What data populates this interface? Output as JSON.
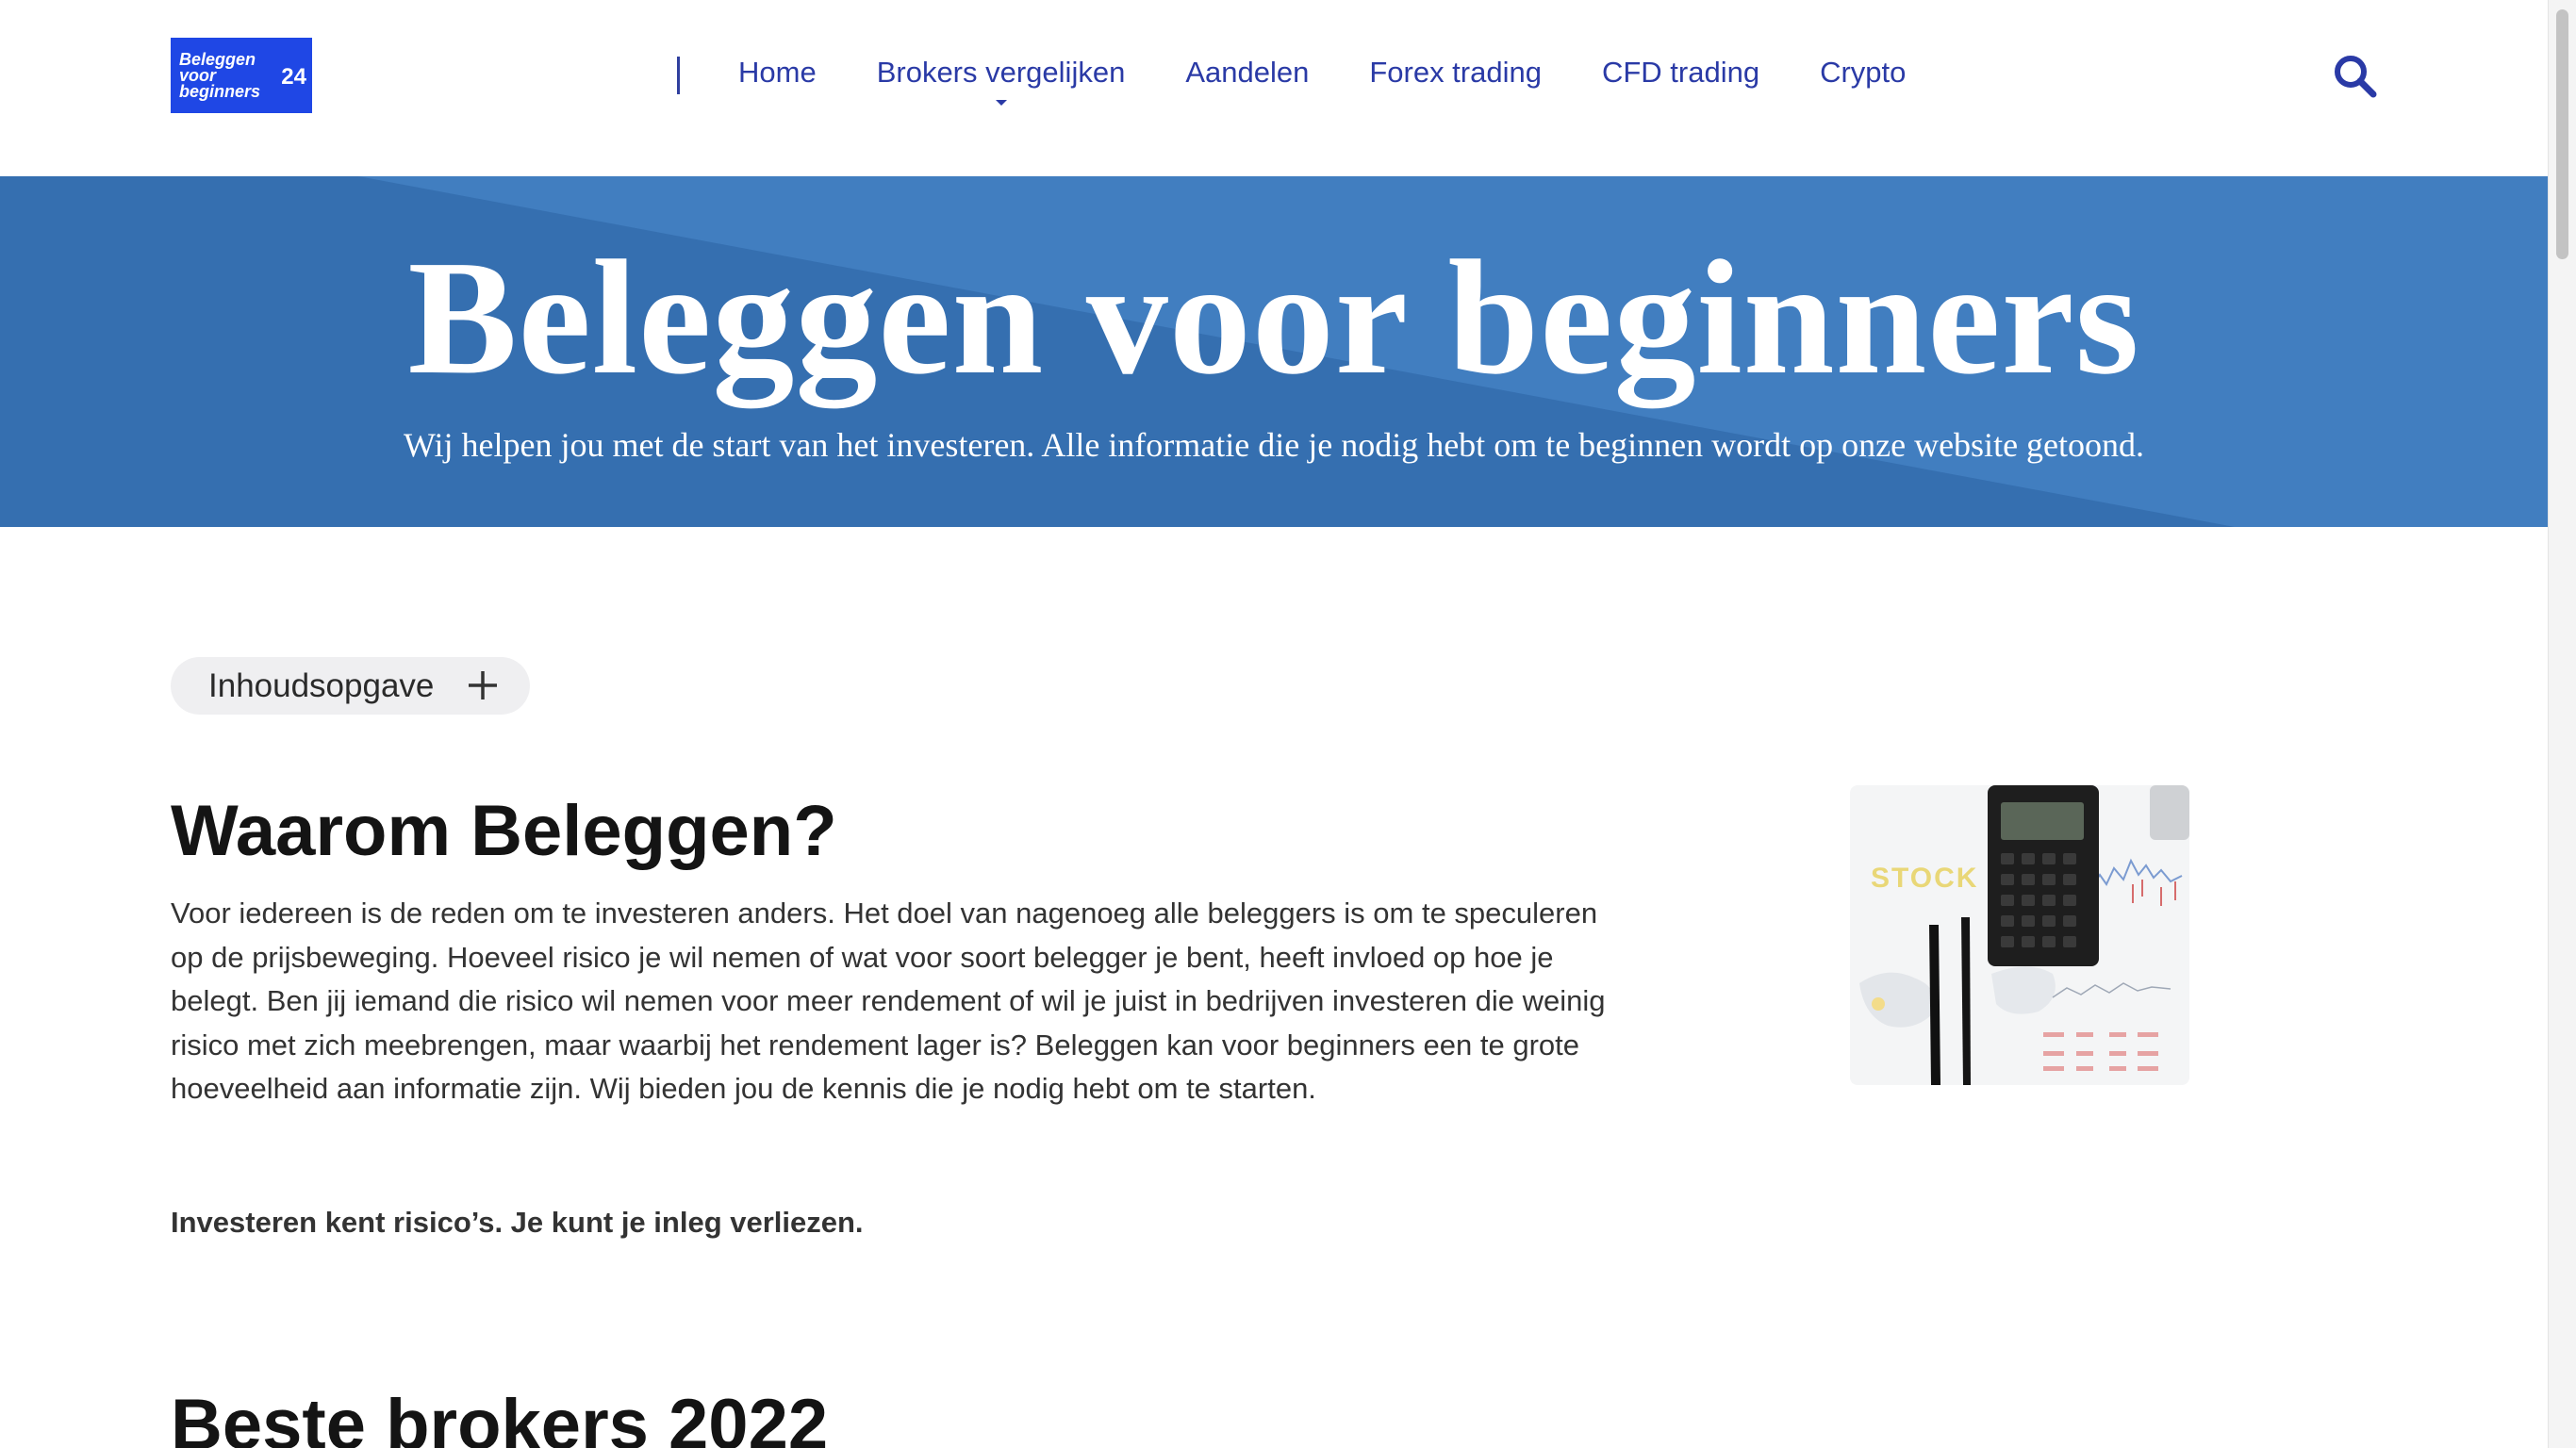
{
  "header": {
    "logo": {
      "text": "Beleggen\nvoor\nbeginners",
      "number": "24",
      "color": "#1f47e5"
    },
    "nav": [
      {
        "label": "Home",
        "has_dropdown": false
      },
      {
        "label": "Brokers vergelijken",
        "has_dropdown": true
      },
      {
        "label": "Aandelen",
        "has_dropdown": false
      },
      {
        "label": "Forex trading",
        "has_dropdown": false
      },
      {
        "label": "CFD trading",
        "has_dropdown": false
      },
      {
        "label": "Crypto",
        "has_dropdown": false
      }
    ],
    "search_icon": "search-icon",
    "link_color": "#2a3aa6"
  },
  "hero": {
    "title": "Beleggen voor beginners",
    "subtitle": "Wij helpen jou met de start van het investeren. Alle informatie die je nodig hebt om te beginnen wordt op onze website getoond.",
    "background_color": "#356fb0"
  },
  "toc": {
    "label": "Inhoudsopgave",
    "icon": "plus-icon"
  },
  "section1": {
    "title": "Waarom Beleggen?",
    "body": "Voor iedereen is de reden om te investeren anders.  Het doel van nagenoeg alle beleggers is om te speculeren op de prijsbeweging. Hoeveel risico je wil nemen of wat voor soort belegger je bent, heeft invloed op hoe je belegt. Ben jij iemand die risico wil nemen voor meer rendement of wil je juist in bedrijven investeren die weinig risico met zich meebrengen, maar waarbij het rendement lager is? Beleggen kan voor beginners een te grote hoeveelheid aan informatie zijn. Wij bieden jou de kennis die je nodig hebt om te starten.",
    "warning": "Investeren kent risico’s. Je kunt je inleg verliezen.",
    "image_text": "STOCK"
  },
  "section2": {
    "title": "Beste brokers 2022"
  }
}
